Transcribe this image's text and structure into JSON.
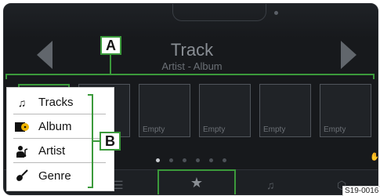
{
  "now_playing": {
    "title": "Track",
    "subtitle": "Artist - Album"
  },
  "tiles": [
    {
      "label": ""
    },
    {
      "label": ""
    },
    {
      "label": "Empty"
    },
    {
      "label": "Empty"
    },
    {
      "label": "Empty"
    },
    {
      "label": "Empty"
    }
  ],
  "page_indicator": {
    "count": 6,
    "active": 1
  },
  "callouts": {
    "a": "A",
    "b": "B"
  },
  "menu": {
    "items": [
      {
        "label": "Tracks",
        "icon": "music-note-icon"
      },
      {
        "label": "Album",
        "icon": "album-icon"
      },
      {
        "label": "Artist",
        "icon": "artist-icon"
      },
      {
        "label": "Genre",
        "icon": "guitar-icon"
      }
    ]
  },
  "bottom_bar": {
    "tabs": [
      {
        "icon": "list-icon"
      },
      {
        "icon": "star-icon",
        "selected": true
      },
      {
        "icon": "music-icon"
      },
      {
        "icon": "source-icon"
      }
    ]
  },
  "figure_code": "S19-0016",
  "colors": {
    "highlight": "#3b9a3b",
    "screen_bg": "#17191c"
  }
}
